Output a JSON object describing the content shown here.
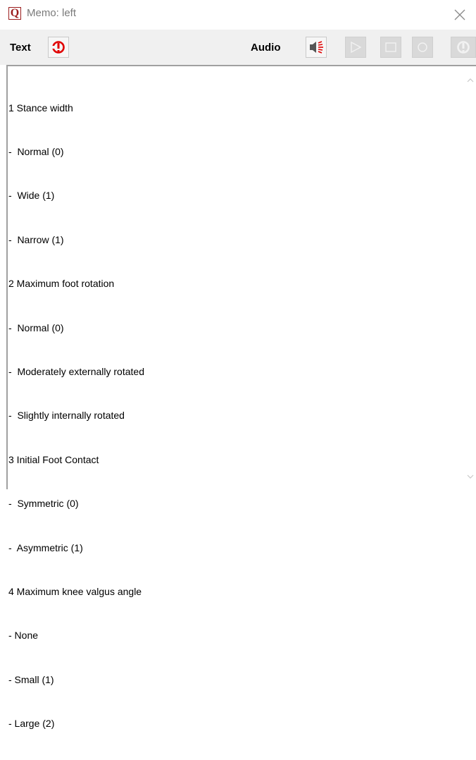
{
  "window": {
    "title": "Memo: left",
    "app_icon_letter": "Q"
  },
  "toolbar": {
    "text_label": "Text",
    "audio_label": "Audio",
    "icons": [
      "text-speak-icon",
      "speaker-icon",
      "play-icon",
      "stop-icon",
      "record-icon",
      "audio-speak-icon"
    ]
  },
  "memo": {
    "lines": [
      "1 Stance width",
      "-  Normal (0)",
      "-  Wide (1)",
      "-  Narrow (1)",
      "2 Maximum foot rotation",
      "-  Normal (0)",
      "-  Moderately externally rotated",
      "-  Slightly internally rotated",
      "3 Initial Foot Contact",
      "-  Symmetric (0)",
      "-  Asymmetric (1)",
      "4 Maximum knee valgus angle",
      "- None",
      "- Small (1)",
      "- Large (2)"
    ]
  },
  "colors": {
    "accent_red": "#e00000",
    "brand_maroon": "#9b1c1c",
    "toolbar_bg": "#f0f0f0"
  }
}
